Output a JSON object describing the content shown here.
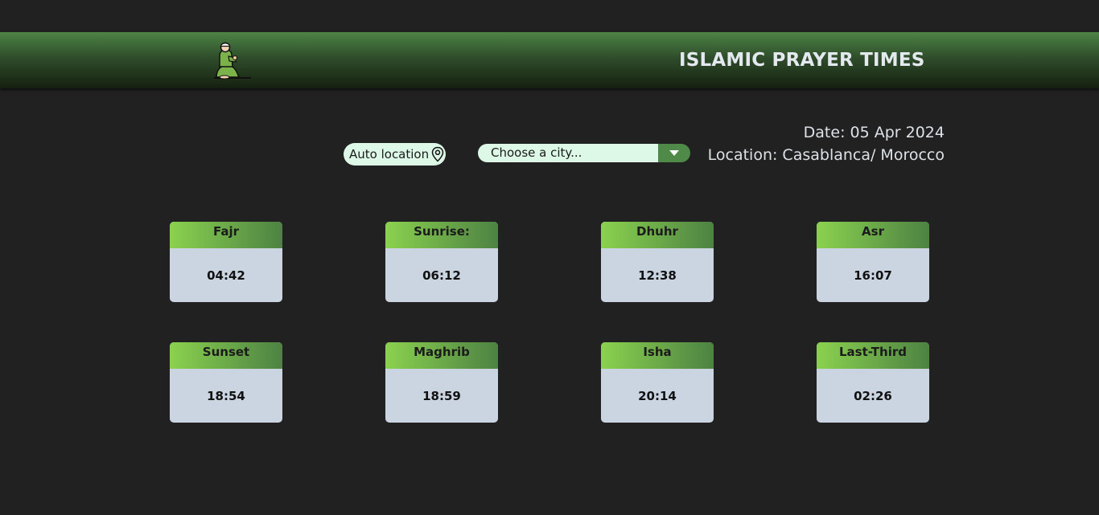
{
  "header": {
    "title": "ISLAMIC PRAYER TIMES",
    "logo_icon": "praying-man-icon"
  },
  "controls": {
    "auto_location_label": "Auto location",
    "auto_location_icon": "map-pin-icon",
    "city_placeholder": "Choose a city...",
    "city_dropdown_icon": "caret-down-icon"
  },
  "info": {
    "date_label": "Date: 05 Apr 2024",
    "location_label": "Location: Casablanca/ Morocco"
  },
  "prayers": [
    {
      "name": "Fajr",
      "time": "04:42"
    },
    {
      "name": "Sunrise:",
      "time": "06:12"
    },
    {
      "name": "Dhuhr",
      "time": "12:38"
    },
    {
      "name": "Asr",
      "time": "16:07"
    },
    {
      "name": "Sunset",
      "time": "18:54"
    },
    {
      "name": "Maghrib",
      "time": "18:59"
    },
    {
      "name": "Isha",
      "time": "20:14"
    },
    {
      "name": "Last-Third",
      "time": "02:26"
    }
  ],
  "colors": {
    "background": "#212121",
    "accent_green": "#4f8a49",
    "light_green": "#8bd24f",
    "input_background": "#ddf8e6",
    "card_body": "#cbd5e1"
  }
}
